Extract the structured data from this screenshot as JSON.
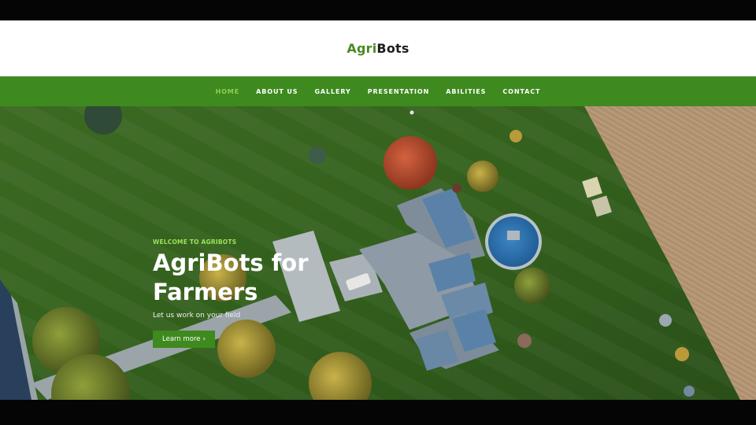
{
  "brand": {
    "logo_part1": "Agri",
    "logo_part2": "Bots"
  },
  "nav": {
    "items": [
      {
        "label": "HOME",
        "active": true
      },
      {
        "label": "ABOUT US",
        "active": false
      },
      {
        "label": "GALLERY",
        "active": false
      },
      {
        "label": "PRESENTATION",
        "active": false
      },
      {
        "label": "ABILITIES",
        "active": false
      },
      {
        "label": "CONTACT",
        "active": false
      }
    ]
  },
  "hero": {
    "eyebrow": "WELCOME TO AGRIBOTS",
    "headline": "AgriBots for Farmers",
    "subline": "Let us work on your field",
    "cta_label": "Learn more",
    "cta_icon": "chevron-right-icon"
  },
  "colors": {
    "brand_green": "#3e8a1f",
    "accent_green": "#8fd14f",
    "text_dark": "#1d1d1d"
  }
}
